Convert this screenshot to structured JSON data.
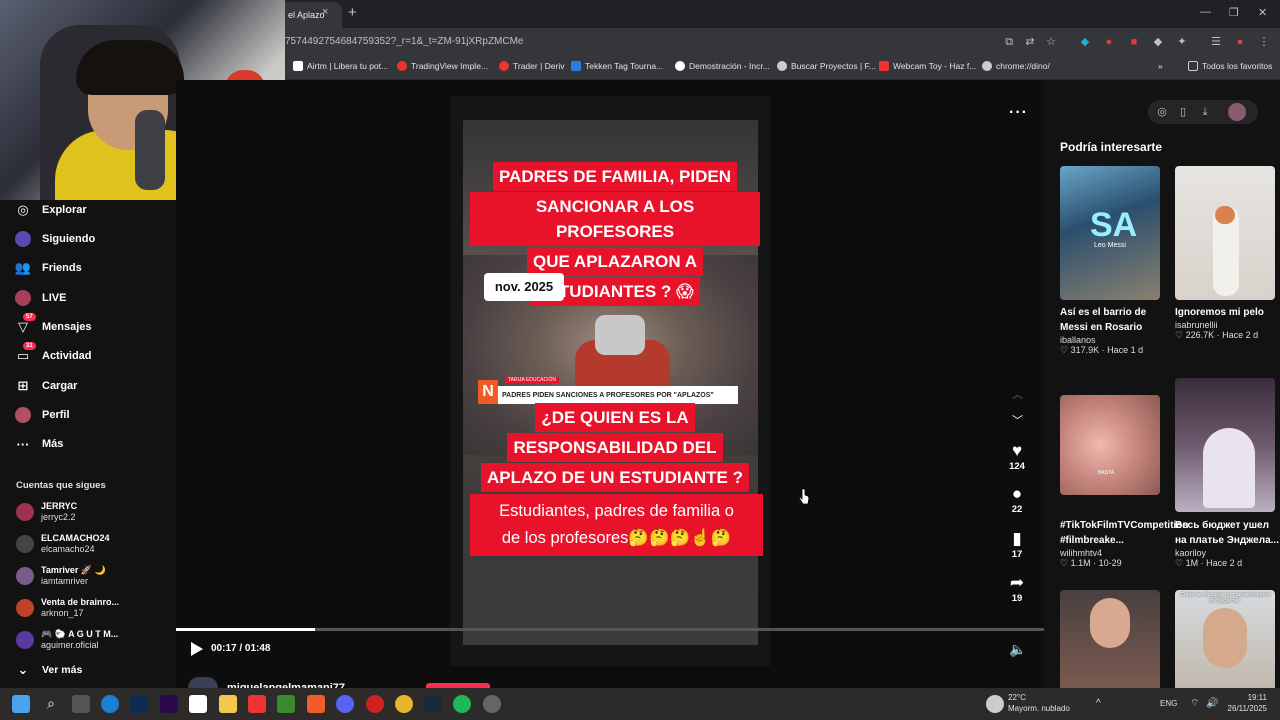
{
  "browser": {
    "tab_title": "el Aplazo",
    "tab_close": "×",
    "new_tab": "+",
    "url": "7574492754684759352?_r=1&_t=ZM-91jXRpZMCMe",
    "bookmarks": [
      "Airtm | Libera tu pot...",
      "TradingView Imple...",
      "Trader | Deriv",
      "Tekken Tag Tourna...",
      "Demostración - Incr...",
      "Buscar Proyectos | F...",
      "Webcam Toy - Haz f...",
      "chrome://dino/"
    ],
    "bookmarks_more": "»",
    "all_favorites": "Todos los favoritos"
  },
  "sidebar": {
    "items": [
      {
        "label": "Explorar",
        "icon": "compass-icon"
      },
      {
        "label": "Siguiendo",
        "icon": "following-icon"
      },
      {
        "label": "Friends",
        "icon": "friends-icon"
      },
      {
        "label": "LIVE",
        "icon": "live-icon"
      },
      {
        "label": "Mensajes",
        "icon": "messages-icon",
        "badge": "57"
      },
      {
        "label": "Actividad",
        "icon": "activity-icon",
        "badge": "31"
      },
      {
        "label": "Cargar",
        "icon": "upload-icon"
      },
      {
        "label": "Perfil",
        "icon": "profile-icon"
      },
      {
        "label": "Más",
        "icon": "more-icon"
      }
    ],
    "following_title": "Cuentas que sigues",
    "accounts": [
      {
        "name": "JERRYC",
        "user": "jerryc2.2",
        "color": "#a03050"
      },
      {
        "name": "ELCAMACHO24",
        "user": "elcamacho24",
        "color": "#333"
      },
      {
        "name": "Tamriver 🚀 🌙",
        "user": "iamtamriver",
        "color": "#7a5a8a"
      },
      {
        "name": "Venta de brainro...",
        "user": "arknon_17",
        "color": "#c0402a"
      },
      {
        "name": "🎮 🐑 A G U T M...",
        "user": "aguimer.oficial",
        "color": "#5a3aa0"
      }
    ],
    "see_more": "Ver más"
  },
  "video": {
    "caption_top": "PADRES DE FAMILIA, PIDEN SANCIONAR A LOS PROFESORES QUE APLAZARON A ESTUDIANTES ? 😱",
    "caption_lines_top": [
      "PADRES DE FAMILIA, PIDEN",
      "SANCIONAR A LOS PROFESORES",
      "QUE APLAZARON A",
      "ESTUDIANTES ? 😱"
    ],
    "date_chip": "nov. 2025",
    "lower_third": "PADRES PIDEN SANCIONES A PROFESORES POR \"APLAZOS\"",
    "lower_third_tags": "TARIJA   EDUCACIÓN",
    "caption_mid_lines": [
      "¿DE QUIEN ES LA",
      "RESPONSABILIDAD DEL",
      "APLAZO DE UN ESTUDIANTE ?"
    ],
    "caption_bottom_lines": [
      "Estudiantes, padres de familia o",
      "de los profesores🤔🤔🤔☝️🤔"
    ],
    "time": "00:17 / 01:48",
    "progress": 0.16,
    "author": "miguelangelmamani77"
  },
  "actions": {
    "likes": "124",
    "comments": "22",
    "saves": "17",
    "shares": "19"
  },
  "right_panel": {
    "title": "Podría interesarte",
    "cards": [
      {
        "title": "Así es el barrio de Messi en Rosario",
        "user": "iballanos",
        "stats": "317.9K · Hace 1 d",
        "thumb_text": "Leo Messi"
      },
      {
        "title": "Ignoremos mi pelo",
        "user": "isabrunellii",
        "stats": "226.7K · Hace 2 d",
        "thumb_text": ""
      },
      {
        "title": "#TikTokFilmTVCompetition #filmbreake...",
        "user": "wilihmhtv4",
        "stats": "1.1M · 10-29",
        "thumb_text": "BASTA"
      },
      {
        "title": "Весь бюджет ушел на платье Энджела...",
        "user": "kaoriloy",
        "stats": "1M · Hace 2 d",
        "thumb_text": ""
      },
      {
        "title": "",
        "user": "",
        "stats": "",
        "thumb_text": ""
      },
      {
        "title": "",
        "user": "",
        "stats": "",
        "thumb_text": "Cómo se disculpa mi mamá después de pegarme:"
      }
    ]
  },
  "taskbar": {
    "weather_temp": "22°C",
    "weather_desc": "Mayorm. nublado",
    "lang": "ENG",
    "clock_time": "19:11",
    "clock_date": "26/11/2025"
  },
  "colors": {
    "tiktok_red": "#fe2c55",
    "caption_red": "#e8132b",
    "tab_bg": "#35363a"
  }
}
